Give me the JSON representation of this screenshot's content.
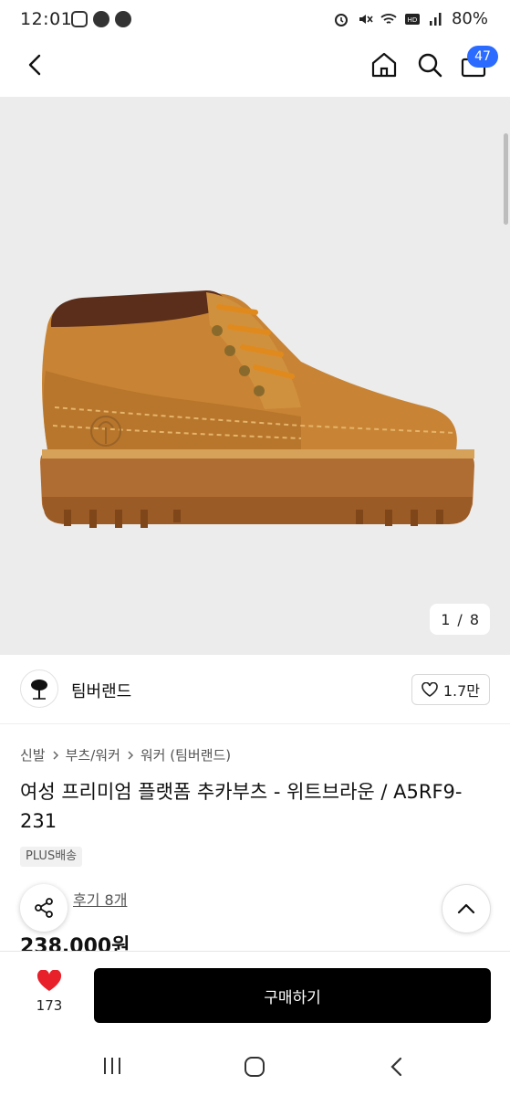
{
  "status_bar": {
    "time": "12:01",
    "battery": "80%",
    "icons": [
      "instagram-icon",
      "kakaotalk-icon",
      "facebook-icon",
      "alarm-icon",
      "mute-icon",
      "wifi-icon",
      "hd-voice-icon",
      "signal-icon",
      "battery-icon"
    ]
  },
  "header": {
    "cart_count": "47"
  },
  "gallery": {
    "pager_current": "1",
    "pager_separator": "/",
    "pager_total": "8"
  },
  "brand": {
    "name": "팀버랜드",
    "likes": "1.7만"
  },
  "breadcrumb": {
    "items": [
      "신발",
      "부츠/워커",
      "워커 (팀버랜드)"
    ]
  },
  "product": {
    "title": "여성 프리미엄 플랫폼 추카부츠 - 위트브라운 / A5RF9-231",
    "shipping_badge": "PLUS배송",
    "review_link": "후기 8개",
    "price": "238,000원"
  },
  "purchase_bar": {
    "wish_count": "173",
    "buy_label": "구매하기"
  },
  "colors": {
    "accent": "#2b6bff",
    "heart": "#e8202a",
    "buy_button": "#000000",
    "hero_background": "#ececec"
  }
}
